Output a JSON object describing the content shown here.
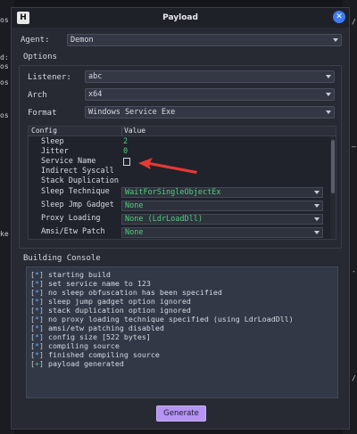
{
  "window": {
    "title": "Payload",
    "icon": "app-icon",
    "close_icon": "close-icon"
  },
  "agent": {
    "label": "Agent:",
    "value": "Demon"
  },
  "options": {
    "title": "Options",
    "listener": {
      "label": "Listener:",
      "value": "abc"
    },
    "arch": {
      "label": "Arch",
      "value": "x64"
    },
    "format": {
      "label": "Format",
      "value": "Windows Service Exe"
    }
  },
  "config_table": {
    "headers": [
      "Config",
      "Value"
    ],
    "rows": [
      {
        "key": "Sleep",
        "value": "2",
        "type": "text"
      },
      {
        "key": "Jitter",
        "value": "0",
        "type": "text"
      },
      {
        "key": "Service Name",
        "value": "",
        "type": "input"
      },
      {
        "key": "Indirect Syscall",
        "value": "",
        "type": "empty"
      },
      {
        "key": "Stack Duplication",
        "value": "",
        "type": "empty"
      },
      {
        "key": "Sleep Technique",
        "value": "WaitForSingleObjectEx",
        "type": "combo"
      },
      {
        "key": "Sleep Jmp Gadget",
        "value": "None",
        "type": "combo"
      },
      {
        "key": "Proxy Loading",
        "value": "None (LdrLoadDll)",
        "type": "combo"
      },
      {
        "key": "Amsi/Etw Patch",
        "value": "None",
        "type": "combo"
      }
    ]
  },
  "console": {
    "title": "Building Console",
    "lines": [
      {
        "mark": "*",
        "text": "starting build"
      },
      {
        "mark": "*",
        "text": "set service name to 123"
      },
      {
        "mark": "*",
        "text": "no sleep obfuscation has been specified"
      },
      {
        "mark": "*",
        "text": "sleep jump gadget option ignored"
      },
      {
        "mark": "*",
        "text": "stack duplication option ignored"
      },
      {
        "mark": "*",
        "text": "no proxy loading technique specified (using LdrLoadDll)"
      },
      {
        "mark": "*",
        "text": "amsi/etw patching disabled"
      },
      {
        "mark": "*",
        "text": "config size [522 bytes]"
      },
      {
        "mark": "*",
        "text": "compiling source"
      },
      {
        "mark": "*",
        "text": "finished compiling source"
      },
      {
        "mark": "+",
        "text": "payload generated"
      }
    ]
  },
  "generate_button": {
    "label": "Generate"
  },
  "annotation": {
    "arrow_color": "#e53935"
  },
  "background_terminal": {
    "left": [
      "os",
      "d:",
      "os",
      "os",
      "os",
      "ke"
    ],
    "right": [
      "/",
      "–",
      "-",
      "/"
    ]
  },
  "colors": {
    "accent": "#b594f2",
    "value_green": "#4ed17a",
    "close_blue": "#3d7bf2",
    "info_blue": "#5da8ff"
  }
}
